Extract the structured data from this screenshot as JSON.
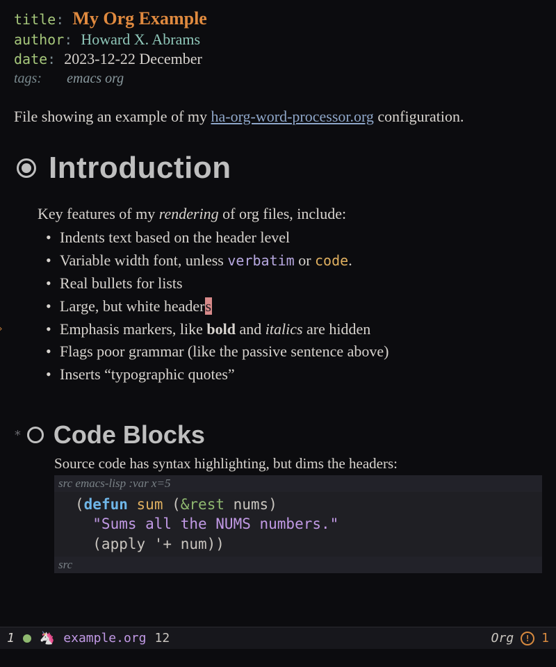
{
  "meta": {
    "title_key": "title",
    "title_val": "My Org Example",
    "author_key": "author",
    "author_val": "Howard X. Abrams",
    "date_key": "date",
    "date_val": "2023-12-22 December",
    "tags_key": "tags:",
    "tags_val": "emacs org",
    "sep": ":"
  },
  "intro_para": {
    "pre": "File showing an example of my ",
    "link": "ha-org-word-processor.org",
    "post": " configuration."
  },
  "h1": "Introduction",
  "features_lead_pre": "Key features of my ",
  "features_lead_em": "rendering",
  "features_lead_post": " of org files, include:",
  "features": {
    "i0": "Indents text based on the header level",
    "i1_pre": "Variable width font, unless ",
    "i1_verbatim": "verbatim",
    "i1_mid": " or ",
    "i1_code": "code",
    "i1_post": ".",
    "i2": "Real bullets for lists",
    "i3_pre": "Large, but white header",
    "i3_cursor": "s",
    "i4_pre": "Emphasis markers, like ",
    "i4_bold": "bold",
    "i4_mid": " and ",
    "i4_italics": "italics",
    "i4_post": " are hidden",
    "i5": "Flags poor grammar (like the passive sentence above)",
    "i6": "Inserts “typographic quotes”"
  },
  "h2_prefix": "*",
  "h2": "Code Blocks",
  "src_desc": "Source code has syntax highlighting, but dims the headers:",
  "src_header_prefix": "src ",
  "src_header_lang": "emacs-lisp :var x=5",
  "src_footer": "src",
  "code": {
    "l1_open": "(",
    "l1_defun": "defun",
    "l1_sp1": " ",
    "l1_name": "sum",
    "l1_sp2": " (",
    "l1_rest": "&rest",
    "l1_args": " nums)",
    "l2": "  \"Sums all the NUMS numbers.\"",
    "l3": "  (apply '+ num))"
  },
  "modeline": {
    "window": "1",
    "file": "example.org",
    "line": "12",
    "mode": "Org",
    "warn_count": "1"
  }
}
